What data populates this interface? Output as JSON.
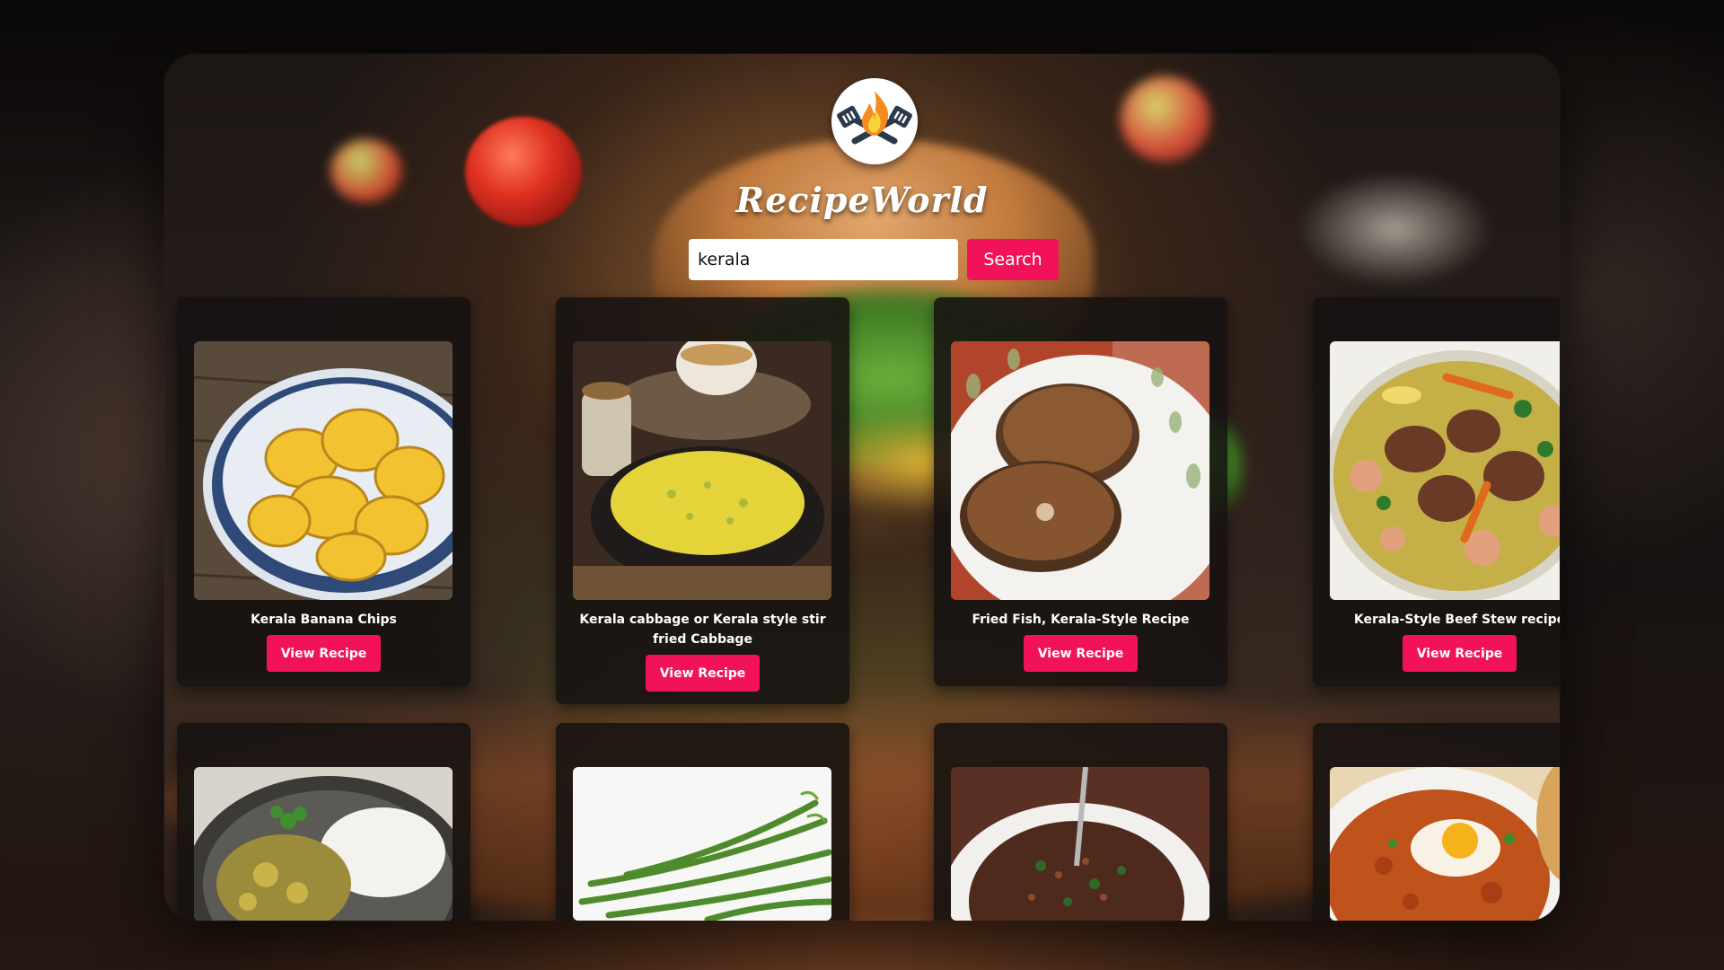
{
  "app": {
    "title": "RecipeWorld",
    "logo_icon": "flame-spatula-icon"
  },
  "search": {
    "value": "kerala",
    "button_label": "Search"
  },
  "colors": {
    "accent": "#f2125a",
    "card_bg": "#161211"
  },
  "recipes": [
    {
      "title": "Kerala Banana Chips",
      "button_label": "View Recipe",
      "image": "banana-chips-bowl"
    },
    {
      "title": "Kerala cabbage or Kerala style stir fried Cabbage",
      "button_label": "View Recipe",
      "image": "cabbage-stir-fry-pot"
    },
    {
      "title": "Fried Fish, Kerala-Style Recipe",
      "button_label": "View Recipe",
      "image": "fried-fish-plate"
    },
    {
      "title": "Kerala-Style Beef Stew recipe",
      "button_label": "View Recipe",
      "image": "beef-stew-bowl"
    },
    {
      "title": "",
      "button_label": "",
      "image": "curry-with-rice"
    },
    {
      "title": "",
      "button_label": "",
      "image": "green-beans"
    },
    {
      "title": "",
      "button_label": "",
      "image": "lentil-stir-fry"
    },
    {
      "title": "",
      "button_label": "",
      "image": "egg-curry"
    }
  ]
}
